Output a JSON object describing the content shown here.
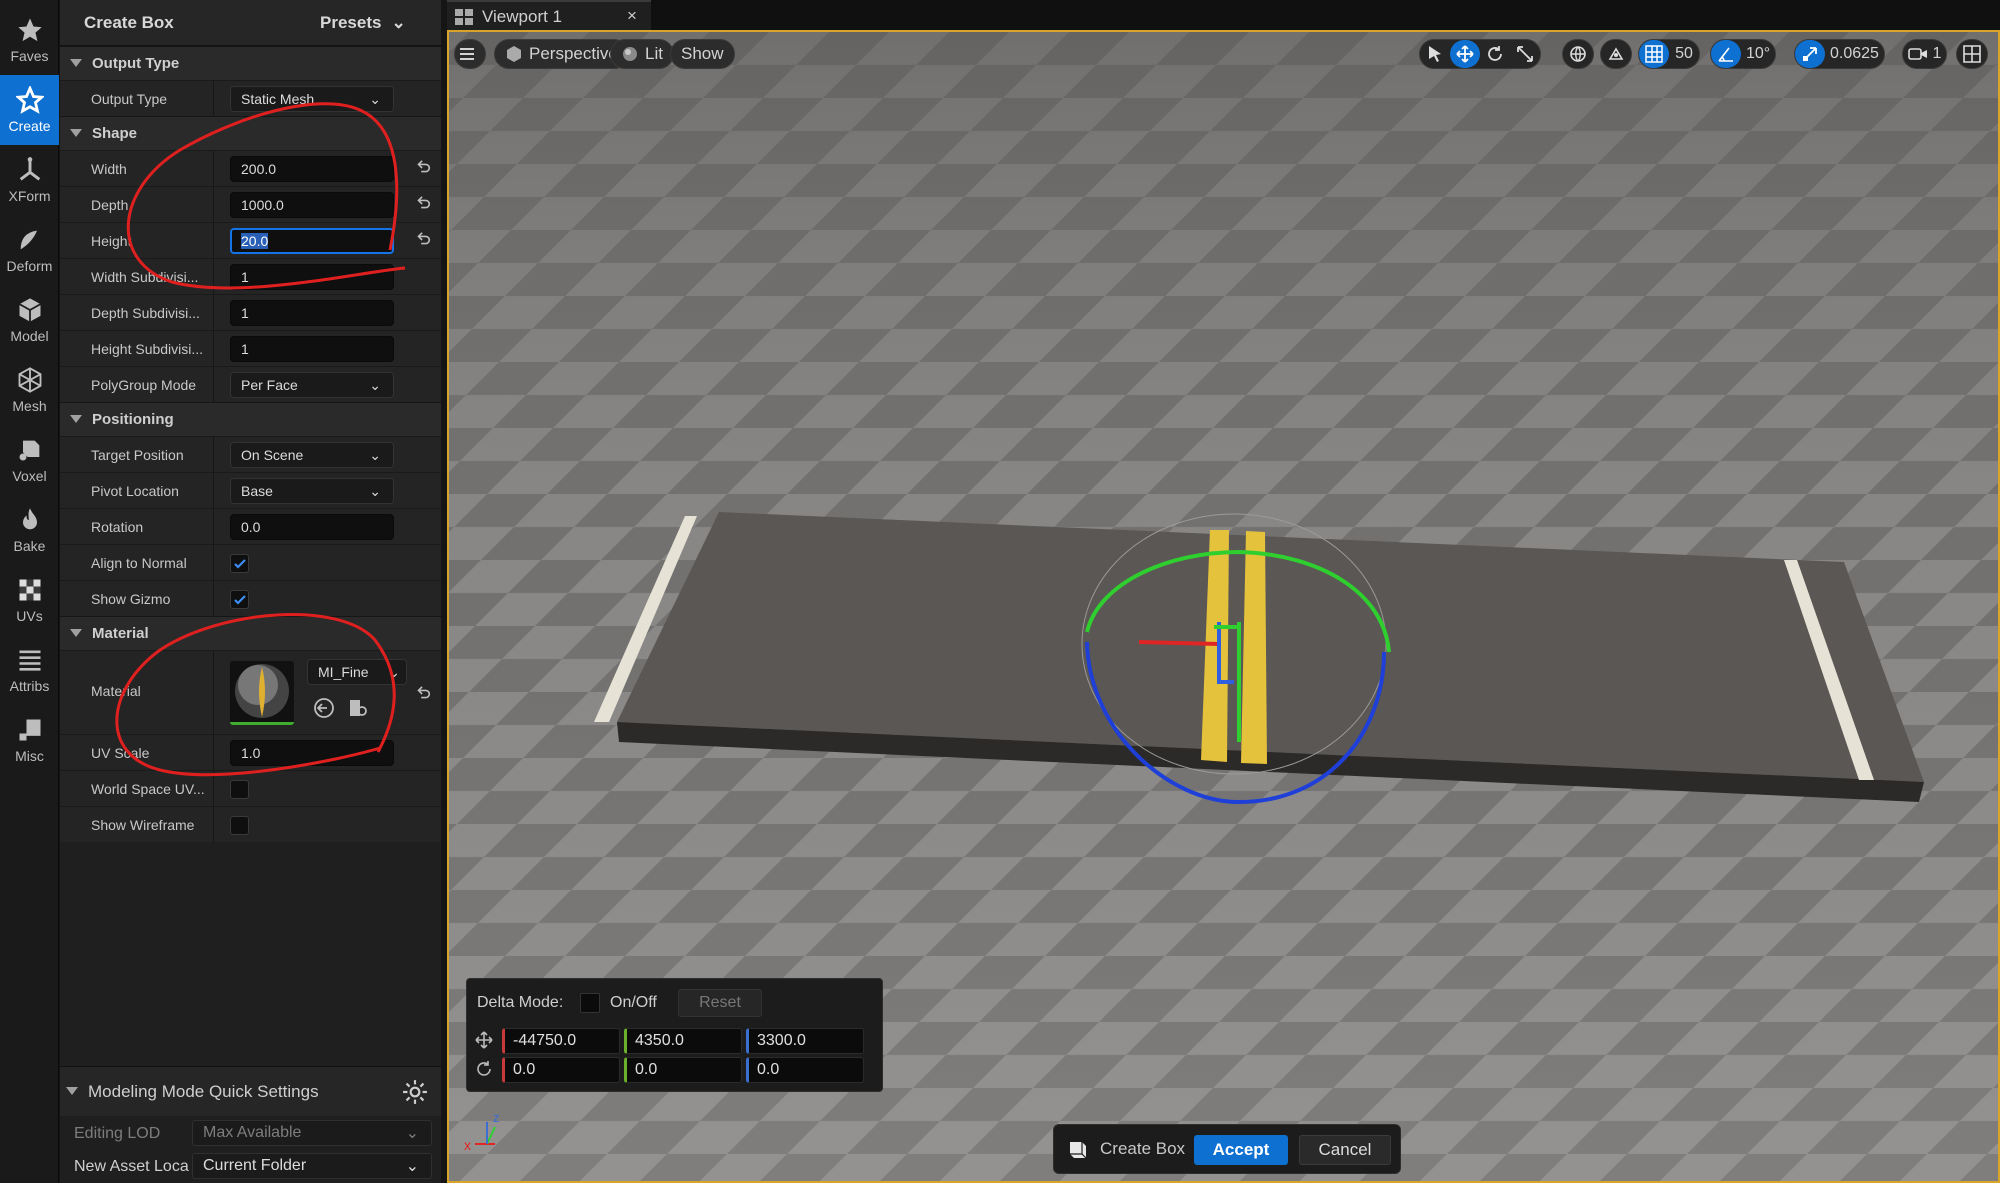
{
  "tool_rail": [
    {
      "label": "Faves",
      "icon": "star-icon"
    },
    {
      "label": "Create",
      "icon": "create-star-icon",
      "active": true
    },
    {
      "label": "XForm",
      "icon": "xform-icon"
    },
    {
      "label": "Deform",
      "icon": "deform-icon"
    },
    {
      "label": "Model",
      "icon": "cube-icon"
    },
    {
      "label": "Mesh",
      "icon": "mesh-icon"
    },
    {
      "label": "Voxel",
      "icon": "voxel-icon"
    },
    {
      "label": "Bake",
      "icon": "flame-icon"
    },
    {
      "label": "UVs",
      "icon": "checker-icon"
    },
    {
      "label": "Attribs",
      "icon": "list-icon"
    },
    {
      "label": "Misc",
      "icon": "misc-icon"
    }
  ],
  "details": {
    "title": "Create Box",
    "presets_label": "Presets",
    "sections": {
      "output_type": "Output Type",
      "shape": "Shape",
      "positioning": "Positioning",
      "material": "Material"
    },
    "output_type": {
      "label": "Output Type",
      "value": "Static Mesh"
    },
    "shape": {
      "width": {
        "label": "Width",
        "value": "200.0"
      },
      "depth": {
        "label": "Depth",
        "value": "1000.0"
      },
      "height": {
        "label": "Height",
        "value": "20.0"
      },
      "width_subdiv": {
        "label": "Width Subdivisi...",
        "value": "1"
      },
      "depth_subdiv": {
        "label": "Depth Subdivisi...",
        "value": "1"
      },
      "height_subdiv": {
        "label": "Height Subdivisi...",
        "value": "1"
      },
      "polygroup_mode": {
        "label": "PolyGroup Mode",
        "value": "Per Face"
      }
    },
    "positioning": {
      "target_position": {
        "label": "Target Position",
        "value": "On Scene"
      },
      "pivot_location": {
        "label": "Pivot Location",
        "value": "Base"
      },
      "rotation": {
        "label": "Rotation",
        "value": "0.0"
      },
      "align_to_normal": {
        "label": "Align to Normal",
        "checked": true
      },
      "show_gizmo": {
        "label": "Show Gizmo",
        "checked": true
      }
    },
    "material": {
      "material": {
        "label": "Material",
        "value": "MI_Fine"
      },
      "uv_scale": {
        "label": "UV Scale",
        "value": "1.0"
      },
      "world_space_uv": {
        "label": "World Space UV...",
        "checked": false
      },
      "show_wireframe": {
        "label": "Show Wireframe",
        "checked": false
      }
    }
  },
  "quick_settings": {
    "title": "Modeling Mode Quick Settings",
    "editing_lod": {
      "label": "Editing LOD",
      "value": "Max Available"
    },
    "new_asset_location": {
      "label": "New Asset Loca",
      "value": "Current Folder"
    }
  },
  "viewport": {
    "tab_label": "Viewport 1",
    "tab_close": "×",
    "perspective": "Perspective",
    "lit": "Lit",
    "show": "Show",
    "grid_snap": "50",
    "rotation_snap": "10°",
    "scale_snap": "0.0625",
    "camera_speed": "1"
  },
  "delta": {
    "title": "Delta Mode:",
    "onoff": "On/Off",
    "reset": "Reset",
    "location": {
      "x": "-44750.0",
      "y": "4350.0",
      "z": "3300.0"
    },
    "rotation": {
      "x": "0.0",
      "y": "0.0",
      "z": "0.0"
    }
  },
  "accept_bar": {
    "title": "Create Box",
    "accept": "Accept",
    "cancel": "Cancel"
  },
  "colors": {
    "accent": "#0e70d1",
    "viewport_border": "#d9a42a",
    "annotation": "#e0201f"
  }
}
